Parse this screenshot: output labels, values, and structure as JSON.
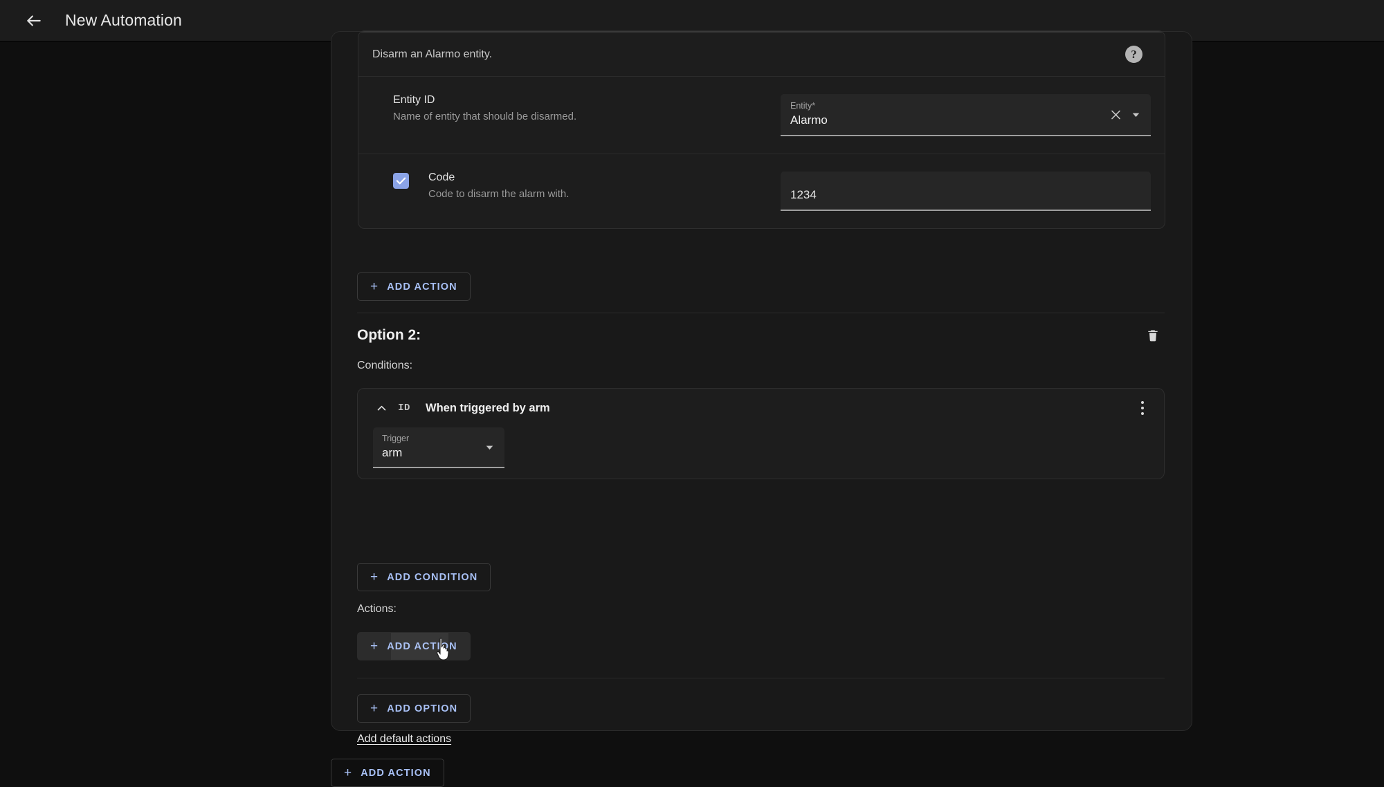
{
  "appbar": {
    "back_icon": "arrow-left-icon",
    "title": "New Automation"
  },
  "action_block": {
    "description": "Disarm an Alarmo entity.",
    "help_icon_label": "?",
    "fields": [
      {
        "label": "Entity ID",
        "help": "Name of entity that should be disarmed.",
        "control": {
          "type": "combobox",
          "label": "Entity*",
          "value": "Alarmo",
          "clear_icon": "close-icon",
          "dropdown_icon": "chevron-down-icon"
        }
      },
      {
        "label": "Code",
        "help": "Code to disarm the alarm with.",
        "checkbox_checked": true,
        "control": {
          "type": "textfield",
          "value": "1234"
        }
      }
    ],
    "add_action_label": "ADD ACTION"
  },
  "option2": {
    "title": "Option 2:",
    "delete_icon": "trash-icon",
    "conditions_label": "Conditions:",
    "condition": {
      "collapse_icon": "chevron-up-icon",
      "badge": "ID",
      "title": "When triggered by arm",
      "overflow_icon": "dots-vertical-icon",
      "trigger_field": {
        "label": "Trigger",
        "value": "arm",
        "dropdown_icon": "chevron-down-icon"
      }
    },
    "add_condition_label": "ADD CONDITION",
    "actions_label": "Actions:",
    "add_action_label": "ADD ACTION"
  },
  "footer": {
    "add_option_label": "ADD OPTION",
    "add_default_actions_label": "Add default actions",
    "add_action_label": "ADD ACTION"
  },
  "colors": {
    "accent": "#a8c0f5",
    "checkbox": "#8ba4e8",
    "page_bg": "#0f0f0f",
    "card_bg": "#1d1d1d",
    "appbar_bg": "#1c1c1c"
  }
}
